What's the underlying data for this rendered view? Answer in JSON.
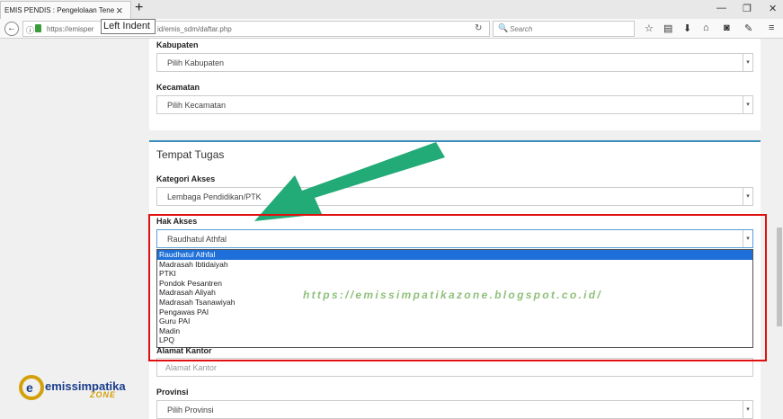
{
  "browser": {
    "tab_title": "EMIS PENDIS : Pengelolaan Tene",
    "tooltip": "Left Indent",
    "url_left": "https://emisper",
    "url_right": "id/emis_sdm/daftar.php",
    "search_placeholder": "Search"
  },
  "form_top": {
    "kabupaten_label": "Kabupaten",
    "kabupaten_value": "Pilih Kabupaten",
    "kecamatan_label": "Kecamatan",
    "kecamatan_value": "Pilih Kecamatan"
  },
  "tempat_tugas": {
    "section_title": "Tempat Tugas",
    "kategori_label": "Kategori Akses",
    "kategori_value": "Lembaga Pendidikan/PTK",
    "hak_label": "Hak Akses",
    "hak_value": "Raudhatul Athfal",
    "hak_options": [
      "Raudhatul Athfal",
      "Madrasah Ibtidaiyah",
      "PTKI",
      "Pondok Pesantren",
      "Madrasah Aliyah",
      "Madrasah Tsanawiyah",
      "Pengawas PAI",
      "Guru PAI",
      "Madin",
      "LPQ"
    ],
    "alamat_label": "Alamat Kantor",
    "alamat_placeholder": "Alamat Kantor",
    "provinsi_label": "Provinsi",
    "provinsi_value": "Pilih Provinsi"
  },
  "watermark": "https://emissimpatikazone.blogspot.co.id/",
  "logo": {
    "name": "emissimpatika",
    "sub": "ZONE"
  },
  "colors": {
    "accent": "#3c8dbc",
    "highlight": "#e01010",
    "arrow": "#22aa77",
    "selected_option": "#1e6fd9"
  }
}
